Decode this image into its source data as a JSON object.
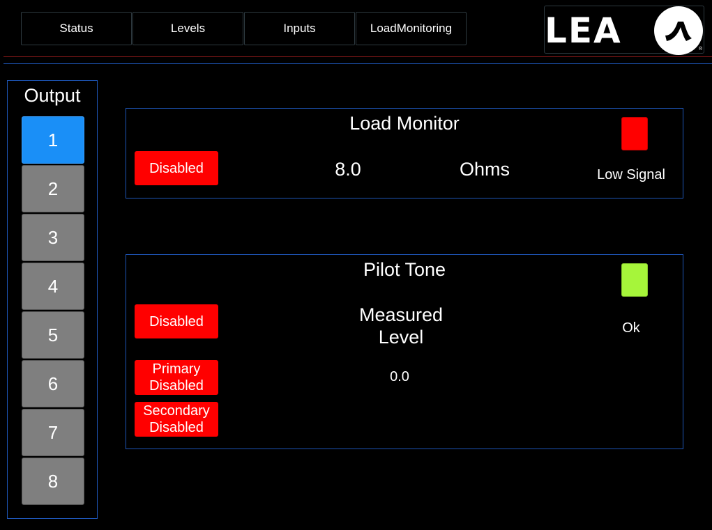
{
  "nav": {
    "tabs": [
      {
        "label": "Status"
      },
      {
        "label": "Levels"
      },
      {
        "label": "Inputs"
      },
      {
        "label": "LoadMonitoring"
      }
    ]
  },
  "logo": {
    "text": "LEA",
    "registered": "®"
  },
  "output": {
    "title": "Output",
    "selected": "1",
    "buttons": [
      "1",
      "2",
      "3",
      "4",
      "5",
      "6",
      "7",
      "8"
    ]
  },
  "load_monitor": {
    "title": "Load Monitor",
    "enable_button": "Disabled",
    "value": "8.0",
    "unit": "Ohms",
    "status_label": "Low Signal",
    "status_color": "#ff0000"
  },
  "pilot_tone": {
    "title": "Pilot Tone",
    "enable_button": "Disabled",
    "primary_button": "Primary Disabled",
    "secondary_button": "Secondary Disabled",
    "measured_label_line1": "Measured",
    "measured_label_line2": "Level",
    "measured_value": "0.0",
    "status_label": "Ok",
    "status_color": "#a6f53a"
  },
  "colors": {
    "accent_blue": "#1a8ff7",
    "panel_border": "#1e56b8",
    "alert_red": "#ff0000",
    "ok_green": "#a6f53a",
    "divider_red": "#8b1a1a",
    "divider_blue": "#1e56b8"
  }
}
